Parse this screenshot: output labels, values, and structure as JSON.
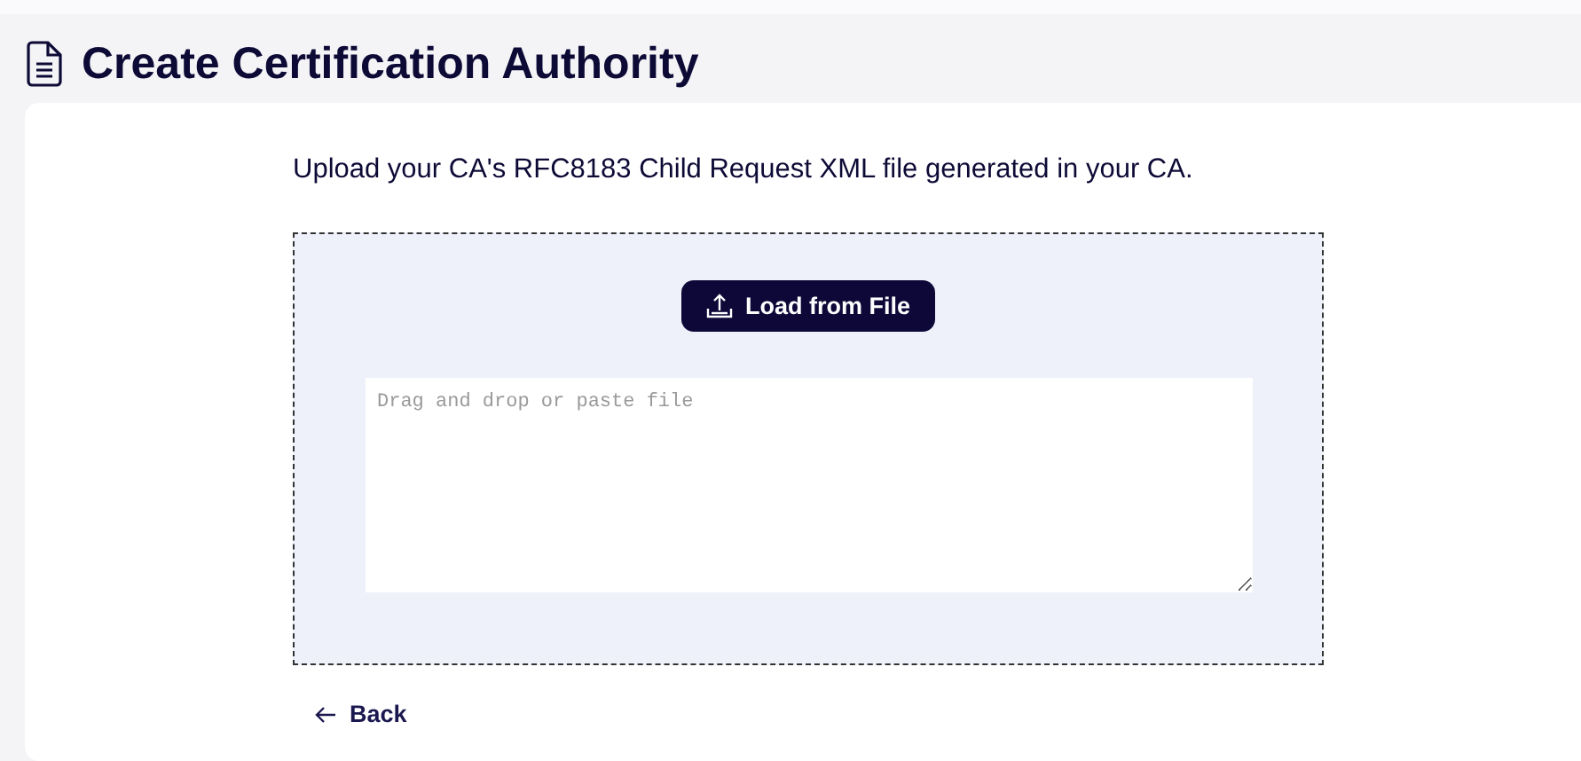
{
  "page": {
    "title": "Create Certification Authority"
  },
  "instruction": "Upload your CA's RFC8183 Child Request XML file generated in your CA.",
  "upload": {
    "button": "Load from File",
    "textarea": {
      "placeholder": "Drag and drop or paste file"
    }
  },
  "back_link": "Back"
}
